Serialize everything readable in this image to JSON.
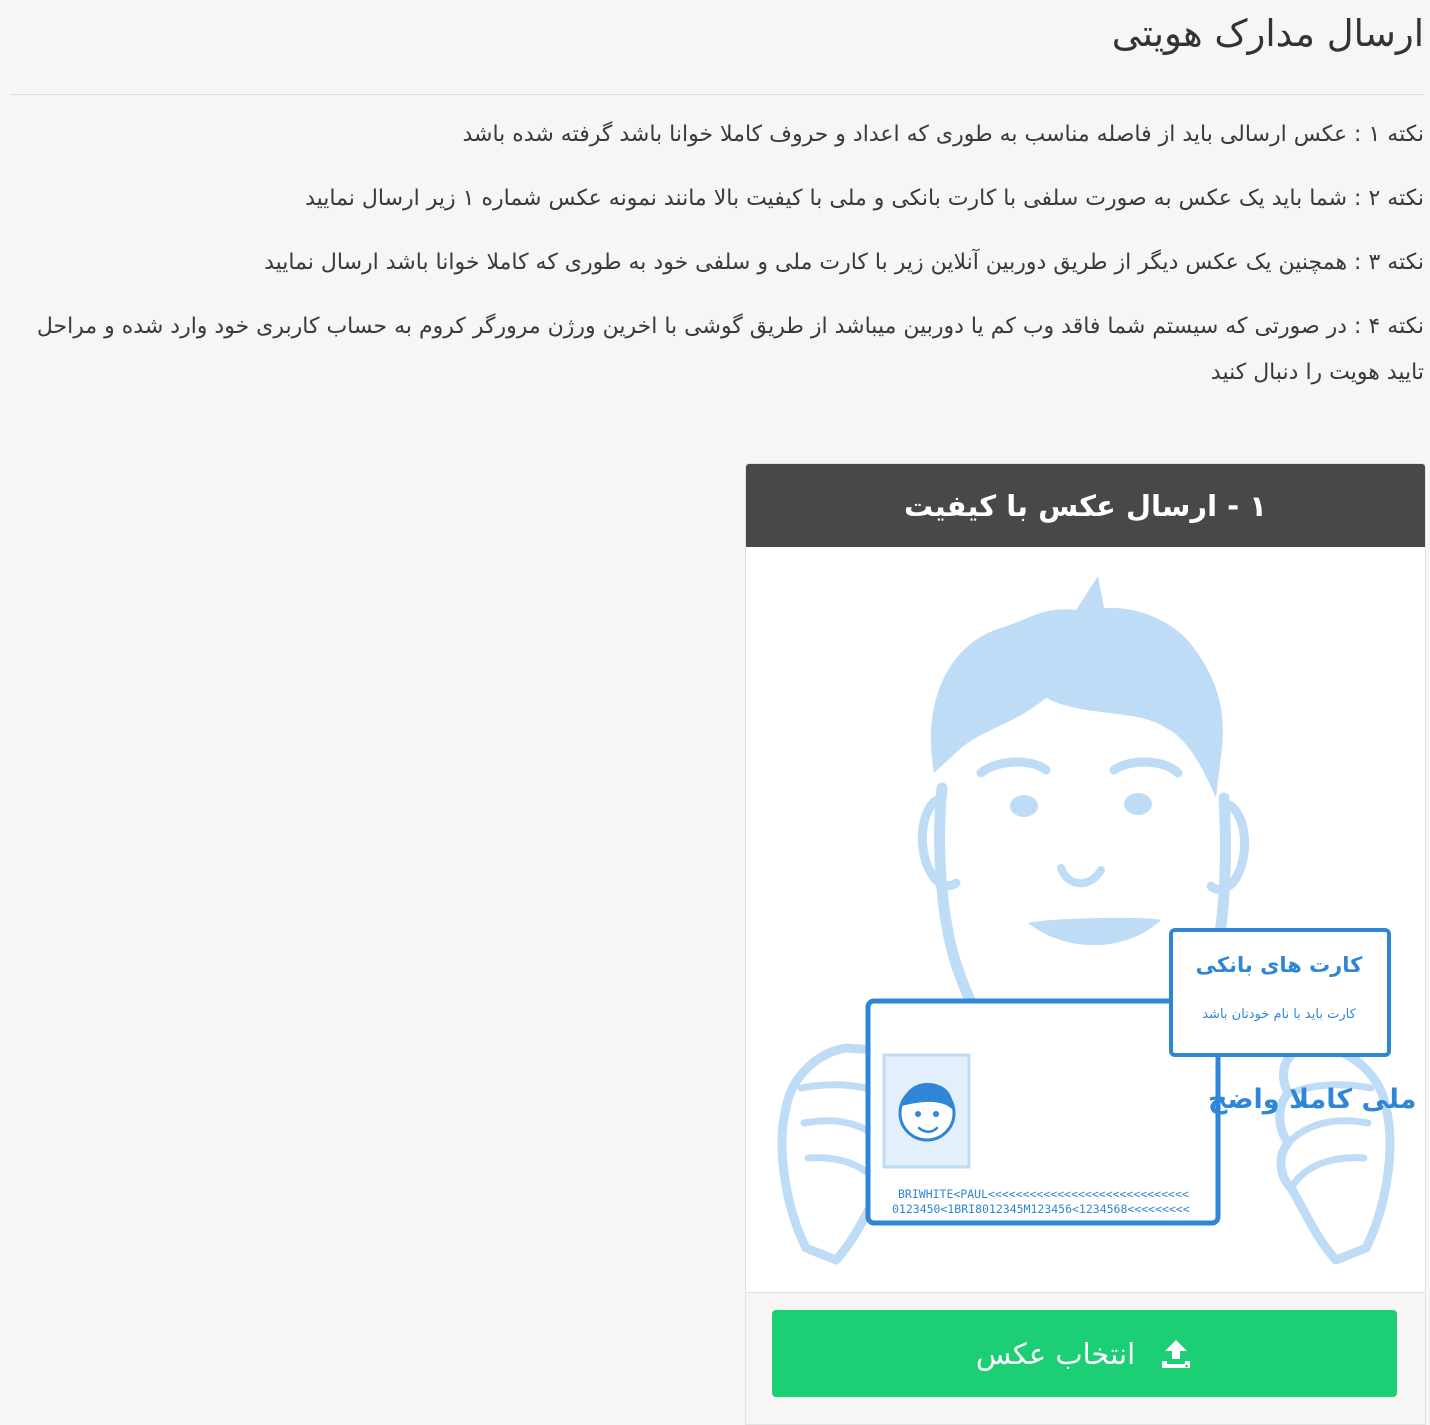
{
  "page": {
    "title": "ارسال مدارک هویتی"
  },
  "notes": [
    "نکته ۱ : عکس ارسالی باید از فاصله مناسب به طوری که اعداد و حروف کاملا خوانا باشد گرفته شده باشد",
    "نکته ۲ : شما باید یک عکس به صورت سلفی با کارت بانکی و ملی با کیفیت بالا مانند نمونه عکس شماره ۱ زیر ارسال نمایید",
    "نکته ۳ : همچنین یک عکس دیگر از طریق دوربین آنلاین زیر با کارت ملی و سلفی خود به طوری که کاملا خوانا باشد ارسال نمایید",
    "نکته ۴ : در صورتی که سیستم شما فاقد وب کم یا دوربین میباشد از طریق گوشی با اخرین ورژن مرورگر کروم به حساب کاربری خود وارد شده و مراحل تایید هویت را دنبال کنید"
  ],
  "upload_card": {
    "title": "۱ - ارسال عکس با کیفیت",
    "illustration": {
      "national_card_label": "کارت ملی کاملا واضح",
      "mrz_line_1": "BRIWHITE<PAUL<<<<<<<<<<<<<<<<<<<<<<<<<<<<<",
      "mrz_line_2": "0123450<1BRI8012345M123456<1234568<<<<<<<<<",
      "bank_card_title": "کارت های بانکی",
      "bank_card_subtitle": "کارت باید با نام خودتان باشد"
    },
    "button_label": "انتخاب عکس",
    "button_icon": "upload-icon"
  },
  "colors": {
    "background": "#f7f6f5",
    "card_header": "#484848",
    "button": "#1ccf74",
    "illustration_light": "#bedcf5",
    "illustration_accent": "#2f86d6"
  }
}
